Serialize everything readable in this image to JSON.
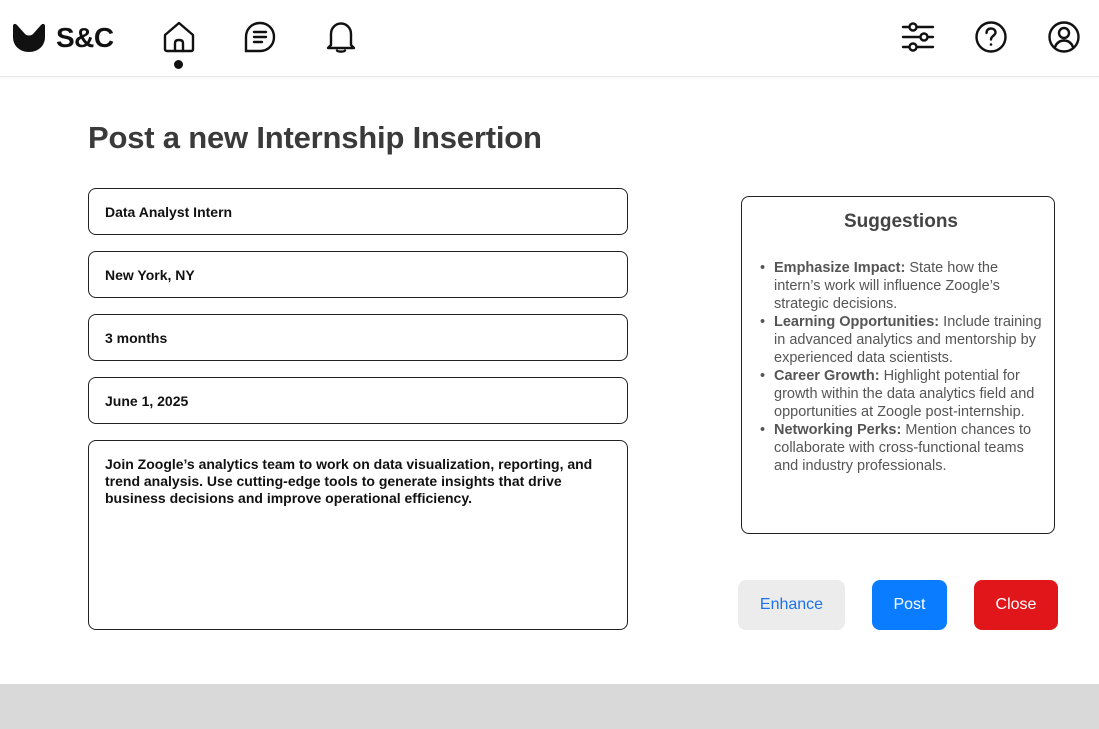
{
  "header": {
    "brand": "S&C",
    "nav_icons": [
      "home-icon",
      "document-list-icon",
      "bell-icon"
    ],
    "right_icons": [
      "sliders-icon",
      "help-icon",
      "user-account-icon"
    ],
    "active_nav": "home"
  },
  "page": {
    "title": "Post a new Internship Insertion"
  },
  "form": {
    "title_value": "Data Analyst Intern",
    "location_value": "New York, NY",
    "duration_value": "3 months",
    "start_date_value": "June 1, 2025",
    "description_value": "Join Zoogle’s analytics team to work on data visualization, reporting, and trend analysis. Use cutting-edge tools to generate insights that drive business decisions and improve operational efficiency."
  },
  "suggestions": {
    "title": "Suggestions",
    "items": [
      {
        "heading": "Emphasize Impact:",
        "text": "State how the intern’s work will influence Zoogle’s strategic decisions."
      },
      {
        "heading": "Learning Opportunities:",
        "text": "Include training in advanced analytics and mentorship by experienced data scientists."
      },
      {
        "heading": "Career Growth:",
        "text": "Highlight potential for growth within the data analytics field and opportunities at Zoogle post-internship."
      },
      {
        "heading": "Networking Perks:",
        "text": "Mention chances to collaborate with cross-functional teams and industry professionals."
      }
    ]
  },
  "actions": {
    "enhance_label": "Enhance",
    "post_label": "Post",
    "close_label": "Close"
  },
  "colors": {
    "primary": "#0a7cff",
    "danger": "#e0161b",
    "enhance_bg": "#ececec",
    "footer_bg": "#d9d9d9"
  }
}
